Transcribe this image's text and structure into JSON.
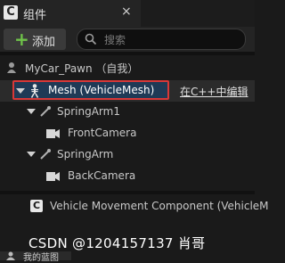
{
  "panel": {
    "title": "组件",
    "close_glyph": "×"
  },
  "toolbar": {
    "add_label": "添加",
    "search_placeholder": "搜索"
  },
  "tree": {
    "root": "MyCar_Pawn （自我）",
    "selected": "Mesh (VehicleMesh)",
    "edit_in_cpp": "在C++中编辑",
    "spring_arm_1": "SpringArm1",
    "front_camera": "FrontCamera",
    "spring_arm": "SpringArm",
    "back_camera": "BackCamera",
    "movement": "Vehicle Movement Component (VehicleM"
  },
  "bottom": {
    "tab_label": "我的蓝图"
  },
  "watermark": "CSDN @1204157137 肖哥",
  "colors": {
    "selection_outline": "#d83838",
    "add_plus": "#6fc34a",
    "selection_fill": "#1f3a56"
  },
  "icons": {
    "component_icon": "square-c-icon",
    "search_icon": "magnifier-icon",
    "skeleton_icon": "skeleton-icon",
    "springarm_icon": "springarm-icon",
    "camera_icon": "camera-icon",
    "pawn_icon": "pawn-icon"
  }
}
